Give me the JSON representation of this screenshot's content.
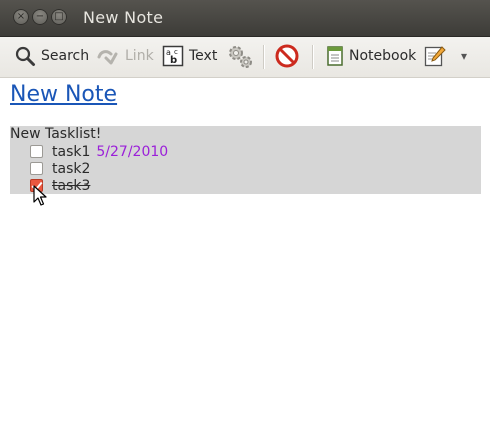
{
  "window": {
    "title": "New Note",
    "controls": {
      "close": "×",
      "minimize": "−",
      "maximize": "□"
    }
  },
  "toolbar": {
    "search_label": "Search",
    "link_label": "Link",
    "text_label": "Text",
    "notebook_label": "Notebook",
    "more_label": "▾",
    "icons": [
      "search-icon",
      "link-icon",
      "text-icon",
      "gear-icon",
      "delete-icon",
      "notebook-icon",
      "edit-icon"
    ]
  },
  "note": {
    "title": "New Note",
    "tasklist": {
      "title": "New Tasklist!",
      "tasks": [
        {
          "label": "task1",
          "date": "5/27/2010",
          "done": false
        },
        {
          "label": "task2",
          "date": "",
          "done": false
        },
        {
          "label": "task3",
          "date": "",
          "done": true
        }
      ]
    }
  },
  "colors": {
    "link": "#1a56b7",
    "date": "#9b20d9",
    "tasklist_bg": "#d6d6d6",
    "checked": "#e9573f"
  }
}
